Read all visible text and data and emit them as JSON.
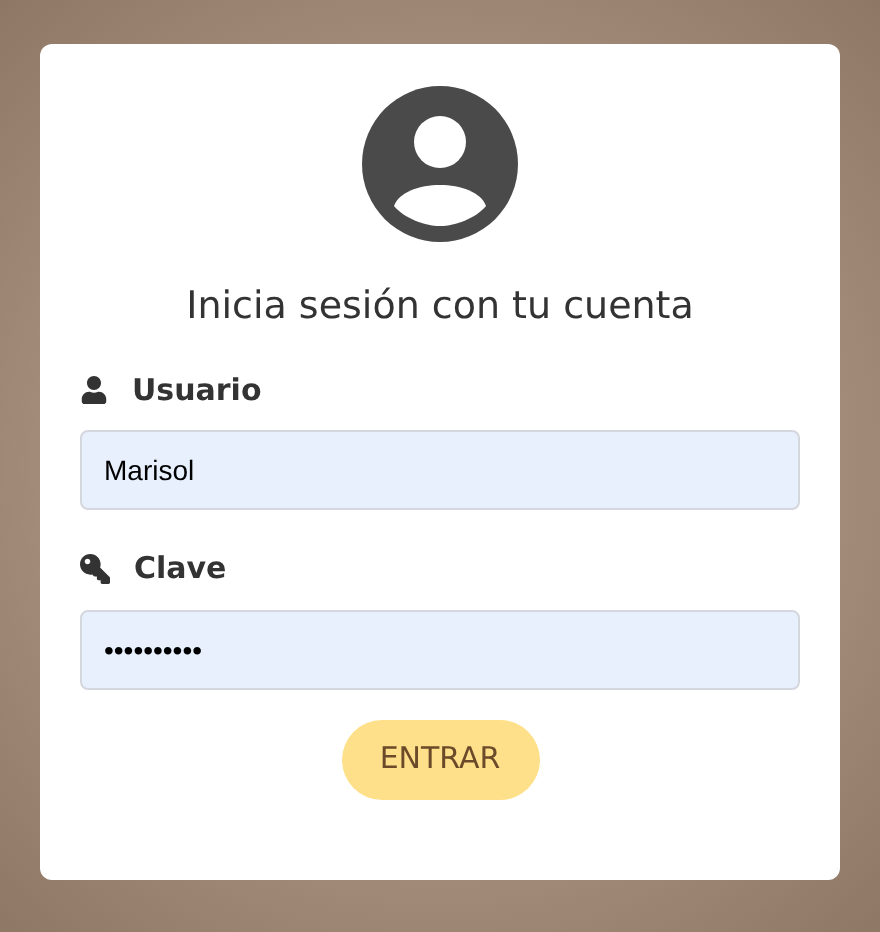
{
  "title": "Inicia sesión con tu cuenta",
  "fields": [
    {
      "kind": "user",
      "label": "Usuario",
      "value": "Marisol"
    },
    {
      "kind": "key",
      "label": "Clave",
      "value": "••••••••••"
    }
  ],
  "submit_button": "ENTRAR"
}
